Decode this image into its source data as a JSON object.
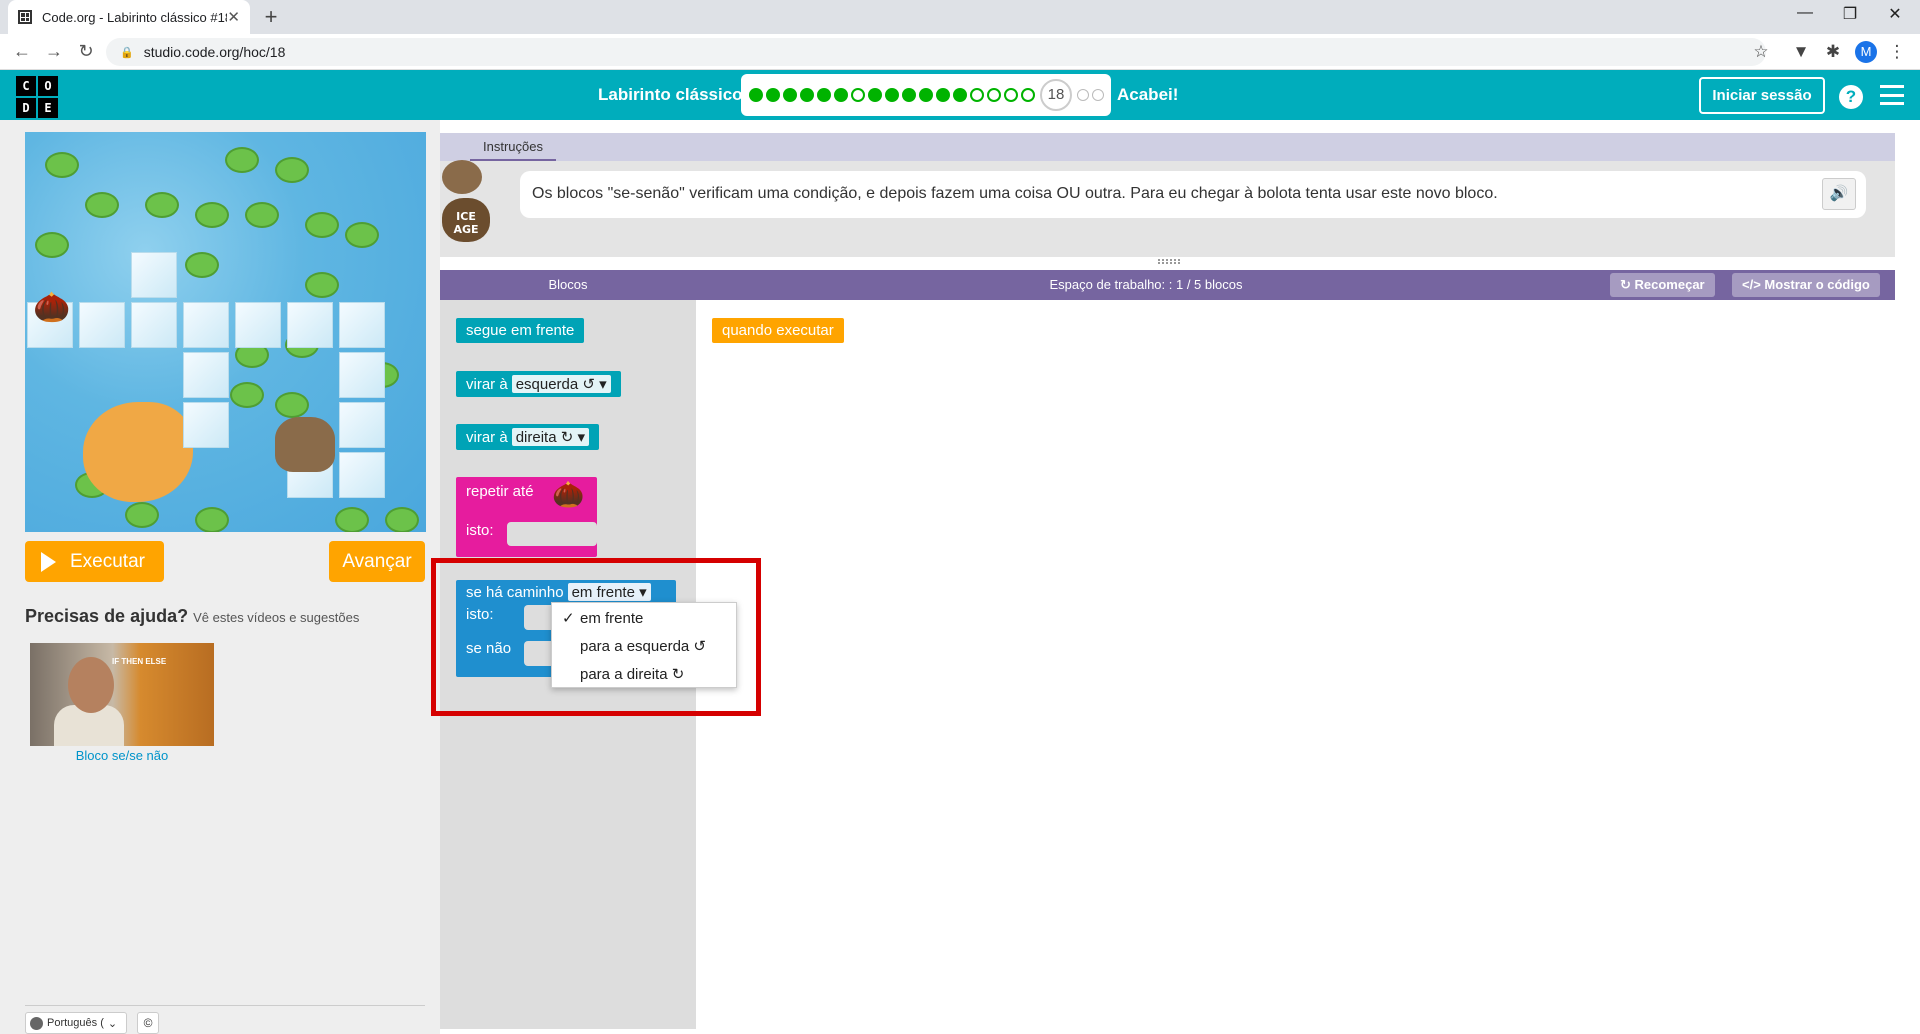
{
  "browser": {
    "tab_title": "Code.org - Labirinto clássico #18",
    "url": "studio.code.org/hoc/18",
    "new_tab": "+",
    "profile_initial": "M"
  },
  "header": {
    "logo_letters": [
      "C",
      "O",
      "D",
      "E"
    ],
    "level_title": "Labirinto clássico",
    "current_level": "18",
    "completed_levels": 17,
    "remaining_levels": 2,
    "done_label": "Acabei!",
    "signin_label": "Iniciar sessão",
    "help": "?",
    "accent_color": "#00adbc"
  },
  "left": {
    "run_label": "Executar",
    "step_label": "Avançar",
    "help_title": "Precisas de ajuda?",
    "help_subtitle": "Vê estes vídeos e sugestões",
    "video_caption": "IF THEN ELSE",
    "video_label": "Bloco se/se não",
    "language": "Português (",
    "copyright": "©"
  },
  "instructions": {
    "tab_label": "Instruções",
    "character_caption": "ICE AGE",
    "text": "Os blocos \"se-senão\" verificam uma condição, e depois fazem uma coisa OU outra. Para eu chegar à bolota tenta usar este novo bloco."
  },
  "workspace": {
    "blocks_header": "Blocos",
    "workspace_header": "Espaço de trabalho: : 1 / 5 blocos",
    "restart_label": "Recomeçar",
    "show_code_label": "Mostrar o código",
    "toolbox": {
      "move_forward": "segue em frente",
      "turn_left_prefix": "virar à",
      "turn_left_value": "esquerda ↺ ▾",
      "turn_right_prefix": "virar à",
      "turn_right_value": "direita ↻ ▾",
      "repeat_until": "repetir até",
      "do_label": "isto:",
      "if_path": "se há caminho",
      "if_path_value": "em frente ▾",
      "if_do_label": "isto:",
      "else_label": "se não"
    },
    "when_run": "quando executar"
  },
  "dropdown": {
    "options": [
      "em frente",
      "para a esquerda ↺",
      "para a direita ↻"
    ],
    "selected_index": 0,
    "check": "✓"
  },
  "colors": {
    "workspace_header": "#7665a0",
    "move_block": "#00a3b6",
    "loop_block": "#e61c9e",
    "event_block": "#ffa400",
    "logic_block": "#1f8fcf",
    "highlight": "#d50000"
  }
}
